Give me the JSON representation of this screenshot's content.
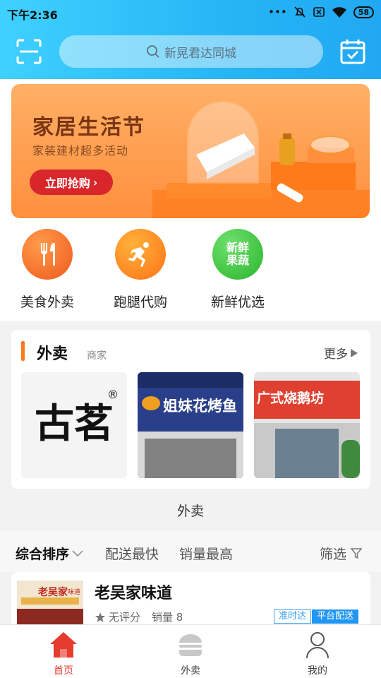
{
  "status_bar": {
    "time": "下午2:36",
    "battery": "58"
  },
  "header": {
    "search_placeholder": "新晃君达同城"
  },
  "banner": {
    "title": "家居生活节",
    "subtitle": "家装建材超多活动",
    "button": "立即抢购"
  },
  "categories": [
    {
      "label": "美食外卖",
      "icon": "fork-knife-icon"
    },
    {
      "label": "跑腿代购",
      "icon": "runner-icon"
    },
    {
      "label": "新鲜优选",
      "icon": "fresh-produce-icon",
      "badge": "新鲜果蔬"
    }
  ],
  "section": {
    "title": "外卖",
    "subtitle": "商家",
    "more": "更多",
    "shops": [
      {
        "sign": "古茗",
        "reg": "®"
      },
      {
        "sign": "姐妹花烤鱼"
      },
      {
        "sign": "广式烧鹅坊"
      }
    ],
    "label_below": "外卖"
  },
  "sort": {
    "items": [
      "综合排序",
      "配送最快",
      "销量最高"
    ],
    "filter": "筛选"
  },
  "store": {
    "sign": "老吴家",
    "sign_suffix": "味道",
    "name": "老吴家味道",
    "rating": "无评分",
    "sales": "销量 8",
    "tags": [
      "准时达",
      "平台配送"
    ]
  },
  "nav": [
    {
      "label": "首页",
      "icon": "home-icon"
    },
    {
      "label": "外卖",
      "icon": "burger-icon"
    },
    {
      "label": "我的",
      "icon": "user-icon"
    }
  ],
  "colors": {
    "accent": "#e53c2f",
    "header": "#26b5f5",
    "orange": "#ff7a1a"
  }
}
